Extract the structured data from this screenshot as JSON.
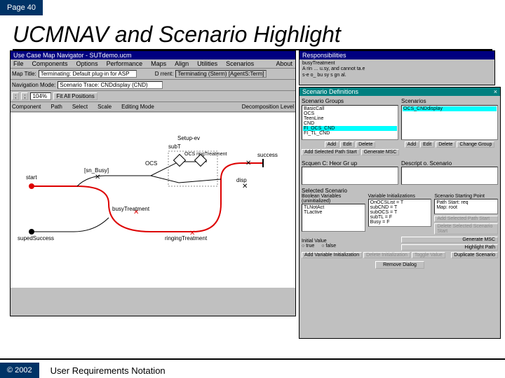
{
  "page_badge": "Page 40",
  "title": "UCMNAV and Scenario Highlight",
  "nav": {
    "title": "Use Case Map Navigator - SUTdemo.ucm",
    "menu": [
      "File",
      "Components",
      "Options",
      "Performance",
      "Maps",
      "Align",
      "Utilities",
      "Scenarios",
      "About"
    ],
    "row1": {
      "label": "Map Title:",
      "value": "Terminating: Default plug-in for ASP"
    },
    "row1b": {
      "label": "D  rrent:",
      "value": "Terminating (Sterm) [AgentS:Term]"
    },
    "row2": {
      "label": "Navigation Mode:",
      "value": "Scenario Trace: CNDdisplay (CND)"
    },
    "row3": {
      "btns": [
        ";",
        ";"
      ],
      "labels": [
        "Component",
        "Path",
        "Select",
        "Scale"
      ],
      "zoom": "104%",
      "fit": "Fit All Positions",
      "mode": "Editing Mode",
      "decomp": "Decomposition Level"
    },
    "diagram": {
      "start": "start",
      "supedSuccess": "supedSuccess",
      "snd_busy": "[sn_Busy]",
      "busyTreatment": "busyTreatment",
      "ringingTreatment": "ringingTreatment",
      "subT": "subT",
      "ocs": "OCS",
      "cnd": "OCS ringTreatment",
      "disp": "disp",
      "success": "success",
      "setup_ev": "Setup-ev"
    }
  },
  "resp": {
    "title": "Responsibilities",
    "body1": "busyTreatment",
    "body2": "A rin … u.sy, and cannot ta.e",
    "body3": "s-e o_ bu sy s gn al."
  },
  "scen": {
    "title": "Scenario Definitions",
    "groups_label": "Scenario Groups",
    "scenarios_label": "Scenarios",
    "groups": [
      "BasicCall",
      "OCS",
      "TeenLine",
      "CND",
      "FI_OCS_CND",
      "FI_TL_CND"
    ],
    "groups_selected": "FI_OCS_CND",
    "scenarios": [
      "OCS_CNDdisplay"
    ],
    "btns_left": [
      "Add",
      "Edit",
      "Delete"
    ],
    "btns_right": [
      "Add",
      "Edit",
      "Delete",
      "Change Group"
    ],
    "add_sel_path1": "Add Selected Path Start",
    "gen_msc1": "Generate MSC",
    "scen_group_label": "Scquen C: Heor  Gr up",
    "desc_label": "Descript o.  Scenario",
    "selected_label": "Selected Scenario",
    "bool_label": "Boolean Variables (uninitialized)",
    "var_init_label": "Variable Initializations",
    "ss_point_label": "Scenario Starting Point",
    "bool_items": [
      "TLNotAct",
      "TLactive"
    ],
    "var_items": [
      "OnOCSList = T",
      "subCND = T",
      "subOCS = T",
      "subTL = F",
      "Busy = F"
    ],
    "ss_items": [
      "Path Start: req",
      "Map: root"
    ],
    "initial_value": "Initial Value",
    "radio_true": "true",
    "radio_false": "false",
    "add_var_init": "Add Variable Initialization",
    "del_init": "Delete Initialization",
    "toggle_val": "Toggle Value",
    "add_sel_path2": "Add Selected Path Start",
    "del_sel_start": "Delete Selected Scenario Start",
    "gen_msc2": "Generate MSC",
    "highlight": "Highlight Path",
    "dup": "Duplicate Scenario",
    "remove": "Remove Dialog"
  },
  "footer": {
    "copyright": "© 2002",
    "text": "User Requirements Notation"
  }
}
